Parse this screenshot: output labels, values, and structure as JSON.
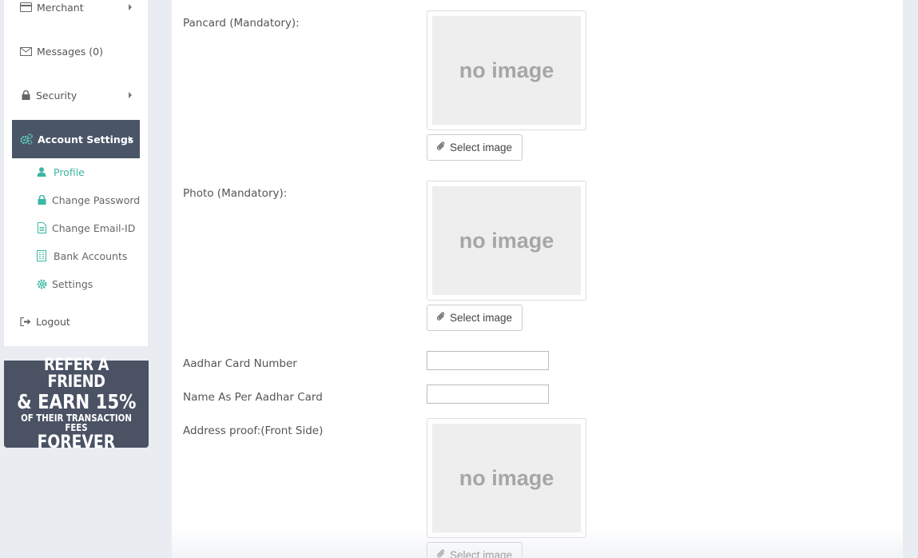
{
  "sidebar": {
    "items": [
      {
        "label": "Merchant"
      },
      {
        "label": "Messages (0)"
      },
      {
        "label": "Security"
      },
      {
        "label": "Account Settings"
      },
      {
        "label": "Logout"
      }
    ],
    "sub_items": [
      {
        "label": "Profile"
      },
      {
        "label": "Change Password"
      },
      {
        "label": "Change Email-ID"
      },
      {
        "label": "Bank Accounts"
      },
      {
        "label": "Settings"
      }
    ]
  },
  "banner": {
    "line1": "REFER A FRIEND",
    "line2": "& EARN 15%",
    "line3": "OF THEIR TRANSACTION FEES",
    "line4": "FOREVER"
  },
  "form": {
    "pancard_label": "Pancard (Mandatory):",
    "photo_label": "Photo (Mandatory):",
    "aadhar_number_label": "Aadhar Card Number",
    "aadhar_name_label": "Name As Per Aadhar Card",
    "address_front_label": "Address proof:(Front Side)",
    "no_image_text": "no image",
    "select_image_label": "Select image"
  },
  "colors": {
    "accent": "#3cb6a3",
    "active_bg": "#4a5568"
  }
}
